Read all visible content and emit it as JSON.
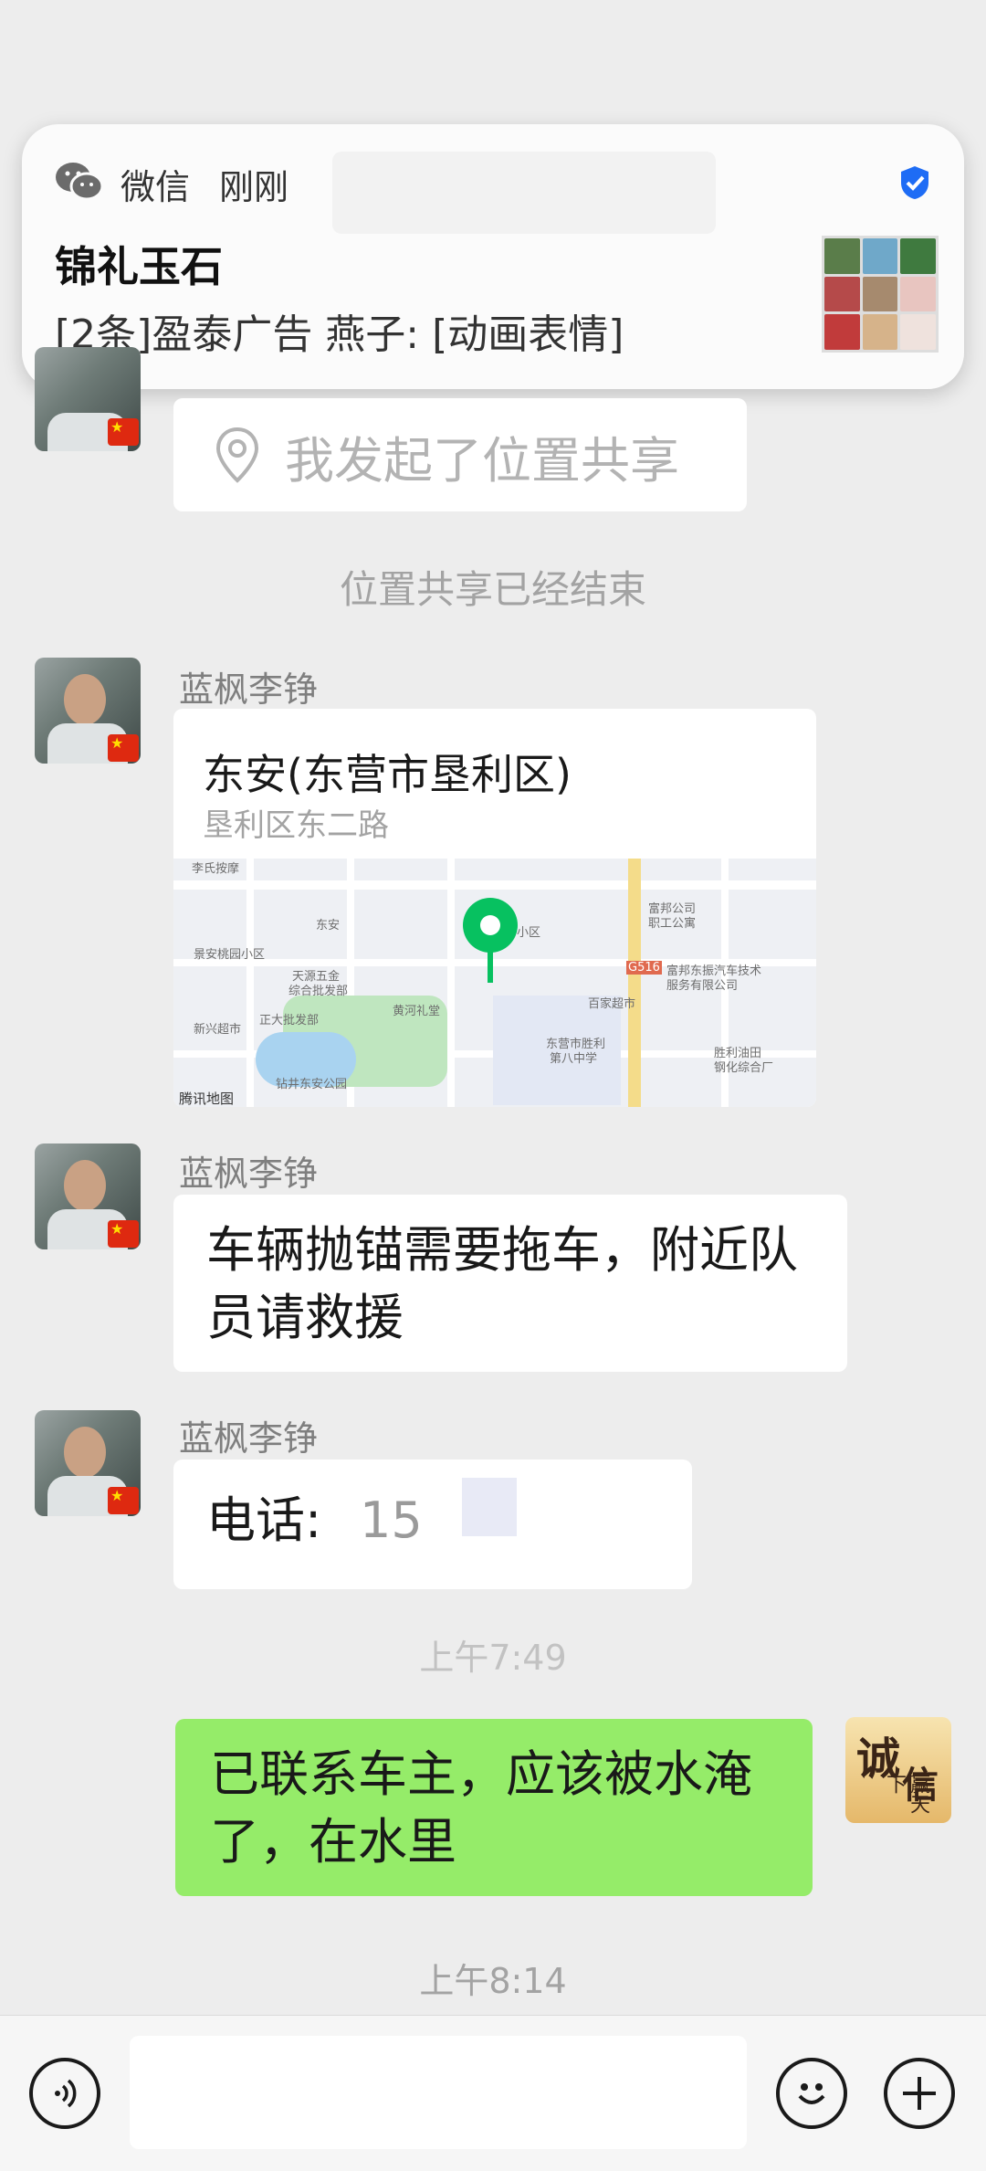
{
  "notification": {
    "app_name": "微信",
    "when": "刚刚",
    "title": "锦礼玉石",
    "body": "[2条]盈泰广告 燕子: [动画表情]"
  },
  "messages": {
    "location_share_started": "我发起了位置共享",
    "location_share_ended": "位置共享已经结束",
    "sender_name": "蓝枫李铮",
    "location_title": "东安(东营市垦利区)",
    "location_subtitle": "垦利区东二路",
    "map_brand": "腾讯地图",
    "tow_request": "车辆抛锚需要拖车，附近队员请救援",
    "phone_label": "电话:",
    "phone_partial": "15",
    "time_1": "上午7:49",
    "my_reply": "已联系车主，应该被水淹了，在水里",
    "time_2": "上午8:14"
  },
  "map_labels": {
    "l1": "李氏按摩",
    "l2": "东安",
    "l3": "小区",
    "l4": "富邦公司",
    "l5": "职工公寓",
    "l6": "G516",
    "l7": "富邦东振汽车技术",
    "l8": "服务有限公司",
    "l9": "景安桃园小区",
    "l10": "天源五金",
    "l11": "综合批发部",
    "l12": "黄河礼堂",
    "l13": "百家超市",
    "l14": "新兴超市",
    "l15": "正大批发部",
    "l16": "东营市胜利",
    "l17": "第八中学",
    "l18": "胜利油田",
    "l19": "钢化综合厂",
    "l20": "钻井东安公园"
  },
  "avatar_me_text": {
    "char1": "诚",
    "char2": "信",
    "small": "赢天下"
  },
  "colors": {
    "background": "#ededed",
    "bubble_me": "#95ec69",
    "map_pin": "#07c160",
    "verified": "#1e6cf5"
  }
}
